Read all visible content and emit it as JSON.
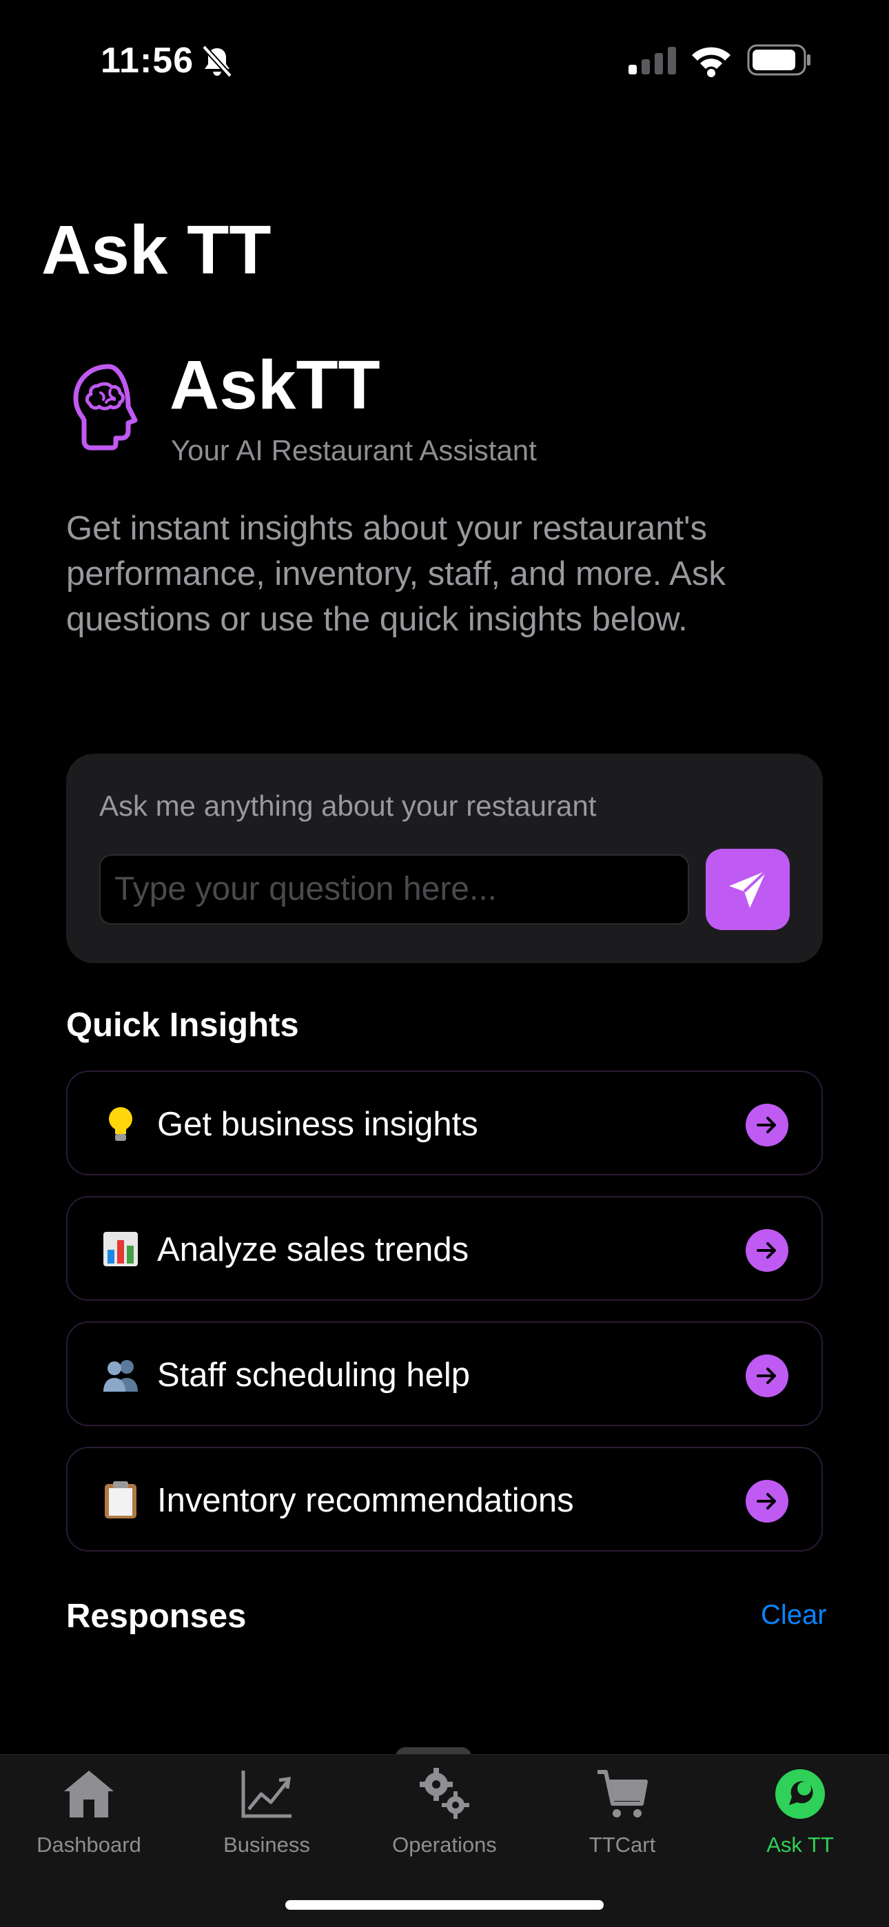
{
  "status_bar": {
    "time": "11:56"
  },
  "page_title": "Ask TT",
  "brand": {
    "name": "AskTT",
    "subtitle": "Your AI Restaurant Assistant",
    "icon": "brain-head-icon",
    "description": "Get instant insights about your restaurant's performance, inventory, staff, and more. Ask questions or use the quick insights below."
  },
  "ask": {
    "label": "Ask me anything about your restaurant",
    "placeholder": "Type your question here...",
    "send_icon": "paper-plane-icon"
  },
  "quick_insights": {
    "title": "Quick Insights",
    "items": [
      {
        "label": "Get business insights",
        "emoji": "lightbulb"
      },
      {
        "label": "Analyze sales trends",
        "emoji": "bar-chart"
      },
      {
        "label": "Staff scheduling help",
        "emoji": "people"
      },
      {
        "label": "Inventory recommendations",
        "emoji": "clipboard"
      }
    ]
  },
  "responses": {
    "title": "Responses",
    "clear_label": "Clear"
  },
  "tabs": [
    {
      "label": "Dashboard",
      "icon": "house-icon"
    },
    {
      "label": "Business",
      "icon": "chart-line-icon"
    },
    {
      "label": "Operations",
      "icon": "gears-icon"
    },
    {
      "label": "TTCart",
      "icon": "cart-icon"
    },
    {
      "label": "Ask TT",
      "icon": "chat-bubble-icon",
      "active": true
    }
  ],
  "colors": {
    "accent": "#bf5af2",
    "active_tab": "#30d158",
    "link": "#0a84ff",
    "card": "#1c1c1e"
  }
}
